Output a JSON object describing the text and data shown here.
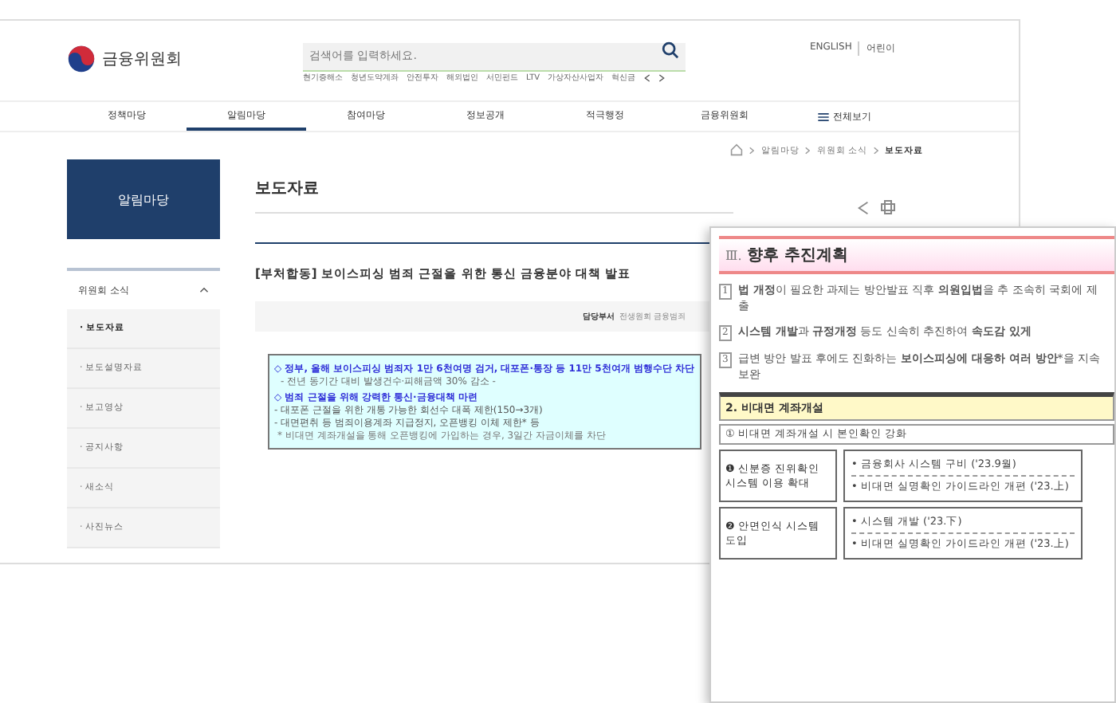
{
  "header": {
    "logo": "금융위원회",
    "search": {
      "placeholder": "검색어를 입력하세요."
    },
    "keywords": [
      "현기증해소",
      "청년도약계좌",
      "안전투자",
      "해외법인",
      "서민펀드",
      "LTV",
      "가상자산사업자",
      "혁신금"
    ],
    "languages": [
      "ENGLISH",
      "어린이"
    ]
  },
  "nav": [
    {
      "label": "정책마당",
      "selected": false
    },
    {
      "label": "알림마당",
      "selected": true
    },
    {
      "label": "참여마당",
      "selected": false
    },
    {
      "label": "정보공개",
      "selected": false
    },
    {
      "label": "적극행정",
      "selected": false
    },
    {
      "label": "금융위원회",
      "selected": false
    }
  ],
  "nav_all": "전체보기",
  "breadcrumb": [
    "알림마당",
    "위원회 소식",
    "보도자료"
  ],
  "sidebar": {
    "title": "알림마당",
    "section": {
      "label": "위원회 소식",
      "expanded": true
    },
    "items": [
      {
        "label": "· 보도자료",
        "selected": true
      },
      {
        "label": "· 보도설명자료",
        "selected": false
      },
      {
        "label": "· 보고영상",
        "selected": false
      },
      {
        "label": "· 공지사항",
        "selected": false
      },
      {
        "label": "· 새소식",
        "selected": false
      },
      {
        "label": "· 사진뉴스",
        "selected": false
      }
    ]
  },
  "main": {
    "title": "보도자료",
    "article_title": "[부처합동] 보이스피싱 범죄 근절을 위한 통신 금융분야 대책 발표",
    "meta_label": "담당부서",
    "meta_value": "전생원회 금융범죄",
    "summary": [
      {
        "kind": "head",
        "text": "◇ 정부, 올해 보이스피싱 범죄자 1만 6천여명 검거, 대포폰·통장 등 11만 5천여개 범행수단 차단"
      },
      {
        "kind": "sub",
        "text": "- 전년 동기간 대비 발생건수·피해금액 30% 감소 -"
      },
      {
        "kind": "head",
        "text": "◇ 범죄 근절을 위해 강력한 통신·금융대책 마련"
      },
      {
        "kind": "dash",
        "text": "- 대포폰 근절을 위한 개통 가능한 회선수 대폭 제한(150→3개)"
      },
      {
        "kind": "dash",
        "text": "- 대면편취 등 범죄이용계좌 지급정지, 오픈뱅킹 이체 제한* 등"
      },
      {
        "kind": "note",
        "text": "* 비대면 계좌개설을 통해 오픈뱅킹에 가입하는 경우, 3일간 자금이체를 차단"
      }
    ]
  },
  "document": {
    "heading_num": "Ⅲ.",
    "heading": "향후 추진계획",
    "items": [
      {
        "num": "1",
        "text": "**법 개정**이 필요한 과제는 방안발표 직후 **의원입법**을 추 조속히 국회에 제출"
      },
      {
        "num": "2",
        "text": "**시스템 개발**과 **규정개정** 등도 신속히 추진하여 **속도감 있게**"
      },
      {
        "num": "3",
        "text": "급변 방안 발표 후에도 진화하는 **보이스피싱에 대응하 여러 방안***을 지속 보완"
      }
    ],
    "table_title": "2. 비대면 계좌개설",
    "table_sub": "① 비대면 계좌개설 시 본인확인 강화",
    "rows": [
      {
        "label": "❶ 신분증 진위확인 시스템 이용 확대",
        "bullets": [
          "• 금융회사 시스템 구비 ('23.9월)",
          "• 비대면 실명확인 가이드라인 개편 ('23.上)"
        ]
      },
      {
        "label": "❷ 안면인식 시스템 도입",
        "bullets": [
          "• 시스템 개발 ('23.下)",
          "• 비대면 실명확인 가이드라인 개편 ('23.上)"
        ]
      }
    ]
  }
}
